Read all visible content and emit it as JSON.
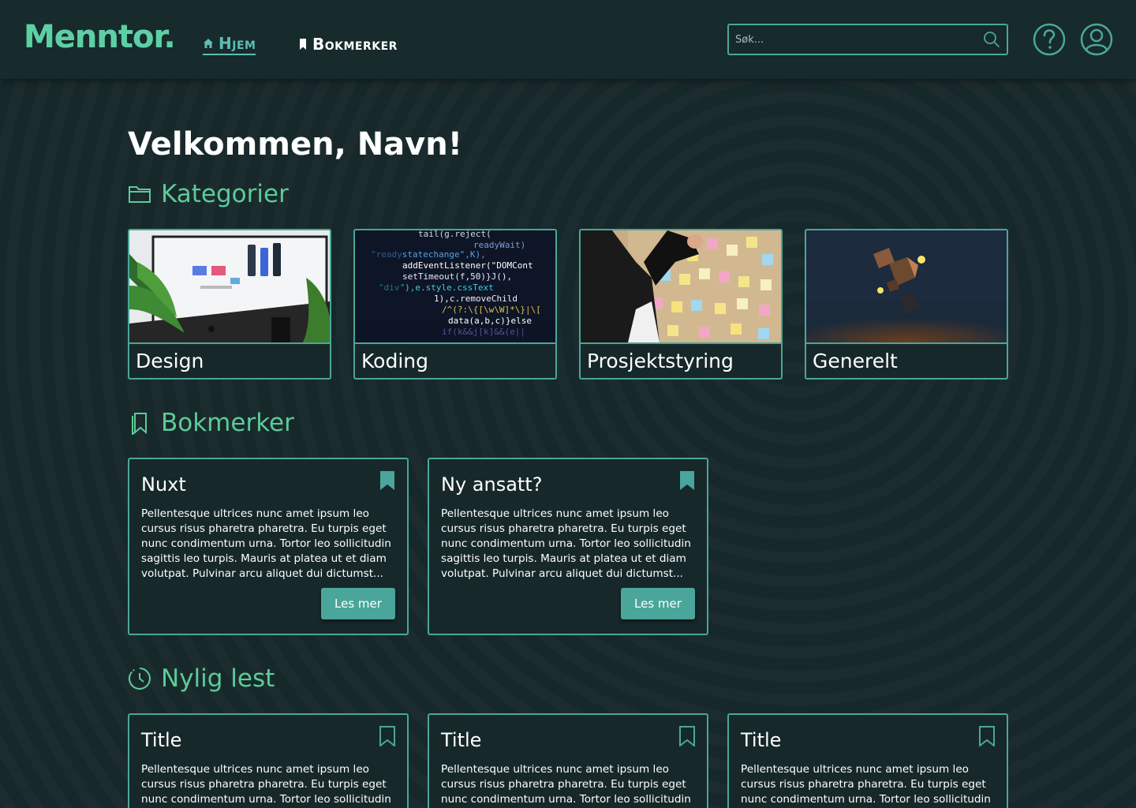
{
  "header": {
    "logo": "Menntor.",
    "nav": [
      {
        "label": "Hjem",
        "icon": "home-icon",
        "active": true
      },
      {
        "label": "Bokmerker",
        "icon": "bookmark-icon",
        "active": false
      }
    ],
    "search_placeholder": "Søk...",
    "icons": [
      "search-icon",
      "help-icon",
      "user-icon"
    ]
  },
  "main": {
    "welcome": "Velkommen, Navn!",
    "sections": {
      "categories": "Kategorier",
      "bookmarks": "Bokmerker",
      "recent": "Nylig lest"
    },
    "categories": [
      {
        "label": "Design",
        "image": "design-image"
      },
      {
        "label": "Koding",
        "image": "code-image"
      },
      {
        "label": "Prosjektstyring",
        "image": "project-board-image"
      },
      {
        "label": "Generelt",
        "image": "cubes-image"
      }
    ],
    "bookmarks": [
      {
        "title": "Nuxt",
        "text": "Pellentesque ultrices nunc amet ipsum leo cursus risus pharetra pharetra. Eu turpis eget nunc condimentum urna. Tortor leo sollicitudin sagittis leo turpis. Mauris at platea ut et diam volutpat. Pulvinar arcu aliquet dui dictumst...",
        "button": "Les mer"
      },
      {
        "title": "Ny ansatt?",
        "text": "Pellentesque ultrices nunc amet ipsum leo cursus risus pharetra pharetra. Eu turpis eget nunc condimentum urna. Tortor leo sollicitudin sagittis leo turpis. Mauris at platea ut et diam volutpat. Pulvinar arcu aliquet dui dictumst...",
        "button": "Les mer"
      }
    ],
    "recent": [
      {
        "title": "Title",
        "text": "Pellentesque ultrices nunc amet ipsum leo cursus risus pharetra pharetra. Eu turpis eget nunc condimentum urna. Tortor leo sollicitudin"
      },
      {
        "title": "Title",
        "text": "Pellentesque ultrices nunc amet ipsum leo cursus risus pharetra pharetra. Eu turpis eget nunc condimentum urna. Tortor leo sollicitudin"
      },
      {
        "title": "Title",
        "text": "Pellentesque ultrices nunc amet ipsum leo cursus risus pharetra pharetra. Eu turpis eget nunc condimentum urna. Tortor leo sollicitudin"
      }
    ]
  },
  "colors": {
    "background": "#17282a",
    "accent": "#4aa69a",
    "heading_green": "#5ccb98",
    "logo_green": "#5ecfa4"
  }
}
